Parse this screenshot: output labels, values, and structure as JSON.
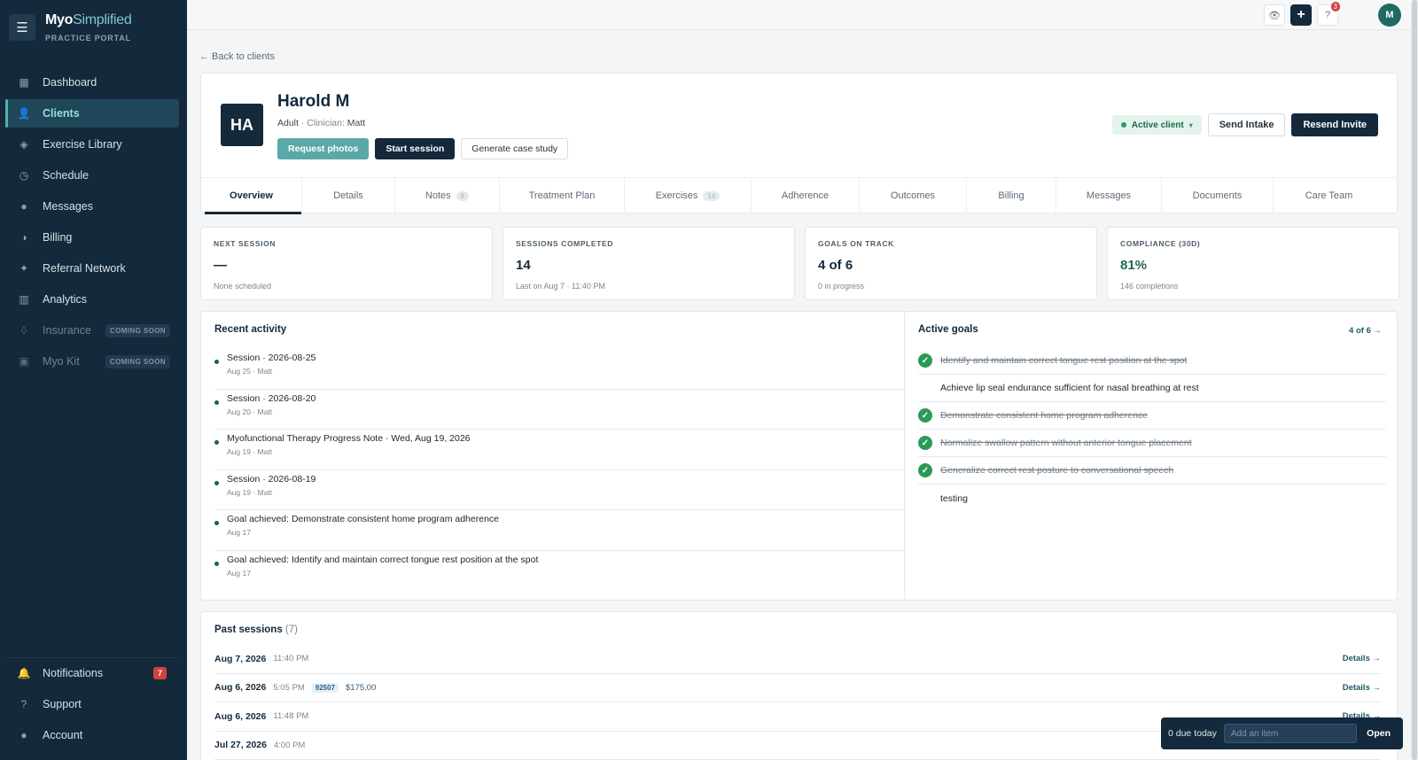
{
  "brand": {
    "name_bold": "Myo",
    "name_light": "Simplified",
    "subtitle": "PRACTICE PORTAL"
  },
  "nav": [
    {
      "label": "Dashboard",
      "icon": "▦",
      "name": "sidebar-item-dashboard"
    },
    {
      "label": "Clients",
      "icon": "👤",
      "name": "sidebar-item-clients"
    },
    {
      "label": "Exercise Library",
      "icon": "◈",
      "name": "sidebar-item-exercise-library"
    },
    {
      "label": "Schedule",
      "icon": "◷",
      "name": "sidebar-item-schedule"
    },
    {
      "label": "Messages",
      "icon": "●",
      "name": "sidebar-item-messages"
    },
    {
      "label": "Billing",
      "icon": "◑",
      "name": "sidebar-item-billing"
    },
    {
      "label": "Referral Network",
      "icon": "✦",
      "name": "sidebar-item-referral-network"
    },
    {
      "label": "Analytics",
      "icon": "▥",
      "name": "sidebar-item-analytics"
    },
    {
      "label": "Insurance",
      "icon": "◊",
      "name": "sidebar-item-insurance",
      "badge": "COMING SOON"
    },
    {
      "label": "Myo Kit",
      "icon": "▣",
      "name": "sidebar-item-myo-kit",
      "badge": "COMING SOON"
    }
  ],
  "nav_bottom": [
    {
      "label": "Notifications",
      "icon": "🔔",
      "badge": "7"
    },
    {
      "label": "Support",
      "icon": "?"
    },
    {
      "label": "Account",
      "icon": "●"
    }
  ],
  "topbar": {
    "help_badge": "3",
    "avatar": "M"
  },
  "back_link": "← Back to clients",
  "client": {
    "initials": "HA",
    "name": "Harold M",
    "type": "Adult",
    "clinician_label": "· Clinician:",
    "clinician": "Matt",
    "status": "Active client"
  },
  "actions": {
    "request_photos": "Request photos",
    "start_session": "Start session",
    "generate_case_study": "Generate case study",
    "send_intake": "Send Intake",
    "resend_invite": "Resend Invite"
  },
  "tabs": [
    {
      "label": "Overview",
      "active": true,
      "width": 114
    },
    {
      "label": "Details",
      "width": 105
    },
    {
      "label": "Notes",
      "count": "8",
      "width": 118
    },
    {
      "label": "Treatment Plan",
      "width": 141
    },
    {
      "label": "Exercises",
      "count": "14",
      "width": 143
    },
    {
      "label": "Adherence",
      "width": 122
    },
    {
      "label": "Outcomes",
      "width": 121
    },
    {
      "label": "Billing",
      "width": 101
    },
    {
      "label": "Messages",
      "width": 119
    },
    {
      "label": "Documents",
      "width": 126
    },
    {
      "label": "Care Team",
      "width": 125
    }
  ],
  "stats": [
    {
      "label": "NEXT SESSION",
      "value": "—",
      "sub": "None scheduled"
    },
    {
      "label": "SESSIONS COMPLETED",
      "value": "14",
      "sub": "Last on Aug 7 · 11:40 PM"
    },
    {
      "label": "GOALS ON TRACK",
      "value": "4 of 6",
      "sub": "0 in progress"
    },
    {
      "label": "COMPLIANCE (30D)",
      "value": "81%",
      "sub": "146 completions"
    }
  ],
  "recent_activity": {
    "title": "Recent activity",
    "items": [
      {
        "title": "Session · 2026-08-25",
        "sub": "Aug 25 · Matt"
      },
      {
        "title": "Session · 2026-08-20",
        "sub": "Aug 20 · Matt"
      },
      {
        "title": "Myofunctional Therapy Progress Note · Wed, Aug 19, 2026",
        "sub": "Aug 19 · Matt"
      },
      {
        "title": "Session · 2026-08-19",
        "sub": "Aug 19 · Matt"
      },
      {
        "title": "Goal achieved: Demonstrate consistent home program adherence",
        "sub": "Aug 17"
      },
      {
        "title": "Goal achieved: Identify and maintain correct tongue rest position at the spot",
        "sub": "Aug 17"
      }
    ]
  },
  "active_goals": {
    "title": "Active goals",
    "link": "4 of 6 →",
    "items": [
      {
        "text": "Identify and maintain correct tongue rest position at the spot",
        "done": true
      },
      {
        "text": "Achieve lip seal endurance sufficient for nasal breathing at rest",
        "done": false
      },
      {
        "text": "Demonstrate consistent home program adherence",
        "done": true
      },
      {
        "text": "Normalize swallow pattern without anterior tongue placement",
        "done": true
      },
      {
        "text": "Generalize correct rest posture to conversational speech",
        "done": true
      },
      {
        "text": "testing",
        "done": false
      }
    ]
  },
  "past_sessions": {
    "title": "Past sessions",
    "count": "(7)",
    "details_label": "Details →",
    "items": [
      {
        "date": "Aug 7, 2026",
        "time": "11:40 PM",
        "details": true
      },
      {
        "date": "Aug 6, 2026",
        "time": "5:05 PM",
        "code": "92507",
        "amount": "$175.00",
        "details": true
      },
      {
        "date": "Aug 6, 2026",
        "time": "11:48 PM",
        "details": true
      },
      {
        "date": "Jul 27, 2026",
        "time": "4:00 PM",
        "details": false
      }
    ]
  },
  "todo": {
    "due": "0 due today",
    "placeholder": "Add an item",
    "open": "Open"
  }
}
